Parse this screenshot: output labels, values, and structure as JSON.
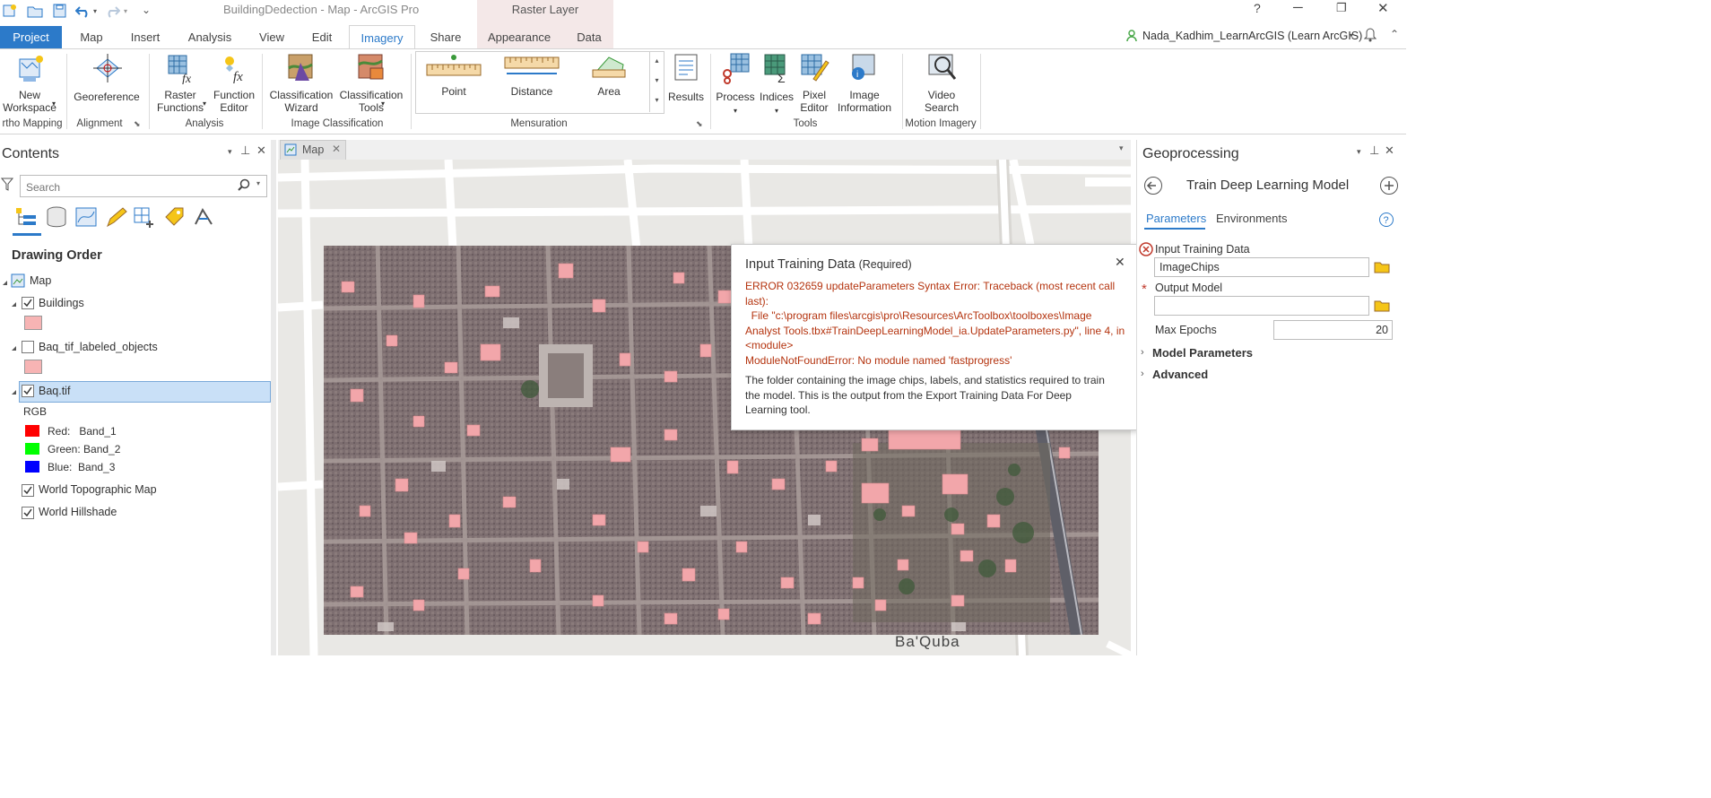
{
  "window": {
    "title": "BuildingDedection - Map - ArcGIS Pro",
    "context_tab": "Raster Layer",
    "help": "?"
  },
  "tabs": [
    "Project",
    "Map",
    "Insert",
    "Analysis",
    "View",
    "Edit",
    "Imagery",
    "Share",
    "Appearance",
    "Data"
  ],
  "user": {
    "name": "Nada_Kadhim_LearnArcGIS (Learn ArcGIS)"
  },
  "ribbon": {
    "new_workspace": "New\nWorkspace",
    "georeference": "Georeference",
    "raster_functions": "Raster\nFunctions",
    "function_editor": "Function\nEditor",
    "classification_wizard": "Classification\nWizard",
    "classification_tools": "Classification\nTools",
    "point": "Point",
    "distance": "Distance",
    "area": "Area",
    "results": "Results",
    "process": "Process",
    "indices": "Indices",
    "pixel_editor": "Pixel\nEditor",
    "image_information": "Image\nInformation",
    "video_search": "Video\nSearch",
    "groups": {
      "ortho": "rtho Mapping",
      "alignment": "Alignment",
      "analysis": "Analysis",
      "image_classification": "Image Classification",
      "mensuration": "Mensuration",
      "tools": "Tools",
      "motion": "Motion Imagery"
    }
  },
  "contents": {
    "title": "Contents",
    "search_placeholder": "Search",
    "drawing_order": "Drawing Order",
    "layers": {
      "map": "Map",
      "buildings": "Buildings",
      "labeled": "Baq_tif_labeled_objects",
      "baq": "Baq.tif",
      "rgb": "RGB",
      "red": "Red:   Band_1",
      "green": "Green: Band_2",
      "blue": "Blue:  Band_3",
      "topo": "World Topographic Map",
      "hillshade": "World Hillshade"
    },
    "colors": {
      "symbol_fill": "#f7b4b4",
      "red": "#ff0000",
      "green": "#00ff00",
      "blue": "#0000ff",
      "selected": "#c9e0f7"
    }
  },
  "map": {
    "tab_label": "Map",
    "place_label": "Ba'Quba"
  },
  "popup": {
    "title": "Input Training Data",
    "required": "(Required)",
    "error_line1": "ERROR 032659 updateParameters Syntax Error: Traceback (most recent call",
    "error_line2": "last):",
    "error_line3": "  File \"c:\\program files\\arcgis\\pro\\Resources\\ArcToolbox\\toolboxes\\Image",
    "error_line4": "Analyst Tools.tbx#TrainDeepLearningModel_ia.UpdateParameters.py\", line 4, in",
    "error_line5": "<module>",
    "error_line6": "ModuleNotFoundError: No module named 'fastprogress'",
    "desc_line1": "The folder containing the image chips, labels, and statistics required to train",
    "desc_line2": "the model. This is the output from the Export Training Data For Deep",
    "desc_line3": "Learning tool."
  },
  "geoprocessing": {
    "title": "Geoprocessing",
    "tool": "Train Deep Learning Model",
    "tab_parameters": "Parameters",
    "tab_environments": "Environments",
    "input_label": "Input Training Data",
    "input_value": "ImageChips",
    "output_label": "Output Model",
    "output_value": "",
    "epochs_label": "Max Epochs",
    "epochs_value": "20",
    "model_params": "Model Parameters",
    "advanced": "Advanced"
  },
  "accent": "#2c7ac9"
}
